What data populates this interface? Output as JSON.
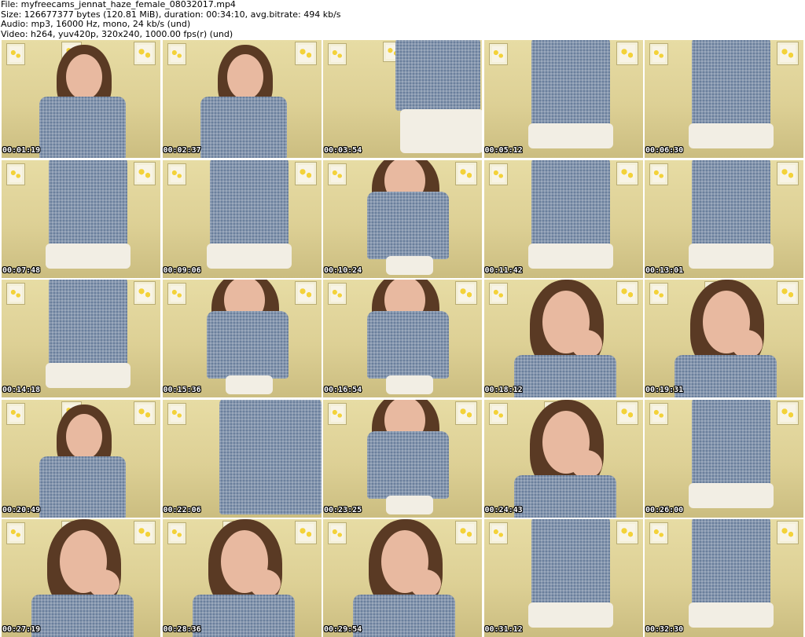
{
  "header": {
    "file_line": "File: myfreecams_jennat_haze_female_08032017.mp4",
    "size_line": "Size: 126677377 bytes (120.81 MiB), duration: 00:34:10, avg.bitrate: 494 kb/s",
    "audio_line": "Audio: mp3, 16000 Hz, mono, 24 kb/s (und)",
    "video_line": "Video: h264, yuv420p, 320x240, 1000.00 fps(r) (und)"
  },
  "thumbnails": [
    {
      "timestamp": "00:01:19",
      "scene": "face-blouse"
    },
    {
      "timestamp": "00:02:37",
      "scene": "face-blouse"
    },
    {
      "timestamp": "00:03:54",
      "scene": "shorts-back"
    },
    {
      "timestamp": "00:05:12",
      "scene": "blouse-shorts"
    },
    {
      "timestamp": "00:06:30",
      "scene": "blouse-shorts"
    },
    {
      "timestamp": "00:07:48",
      "scene": "blouse-shorts"
    },
    {
      "timestamp": "00:09:06",
      "scene": "blouse-shorts"
    },
    {
      "timestamp": "00:10:24",
      "scene": "leaning-face"
    },
    {
      "timestamp": "00:11:42",
      "scene": "blouse-shorts"
    },
    {
      "timestamp": "00:13:01",
      "scene": "blouse-shorts"
    },
    {
      "timestamp": "00:14:18",
      "scene": "blouse-shorts"
    },
    {
      "timestamp": "00:15:36",
      "scene": "leaning-face"
    },
    {
      "timestamp": "00:16:54",
      "scene": "leaning-face"
    },
    {
      "timestamp": "00:18:12",
      "scene": "face-close"
    },
    {
      "timestamp": "00:19:31",
      "scene": "face-close"
    },
    {
      "timestamp": "00:20:49",
      "scene": "face-blouse"
    },
    {
      "timestamp": "00:22:06",
      "scene": "blouse-close"
    },
    {
      "timestamp": "00:23:25",
      "scene": "leaning-face"
    },
    {
      "timestamp": "00:24:43",
      "scene": "face-close"
    },
    {
      "timestamp": "00:26:00",
      "scene": "blouse-shorts"
    },
    {
      "timestamp": "00:27:19",
      "scene": "face-close"
    },
    {
      "timestamp": "00:28:36",
      "scene": "face-close"
    },
    {
      "timestamp": "00:29:54",
      "scene": "face-close"
    },
    {
      "timestamp": "00:31:12",
      "scene": "blouse-shorts"
    },
    {
      "timestamp": "00:32:30",
      "scene": "blouse-shorts"
    }
  ]
}
